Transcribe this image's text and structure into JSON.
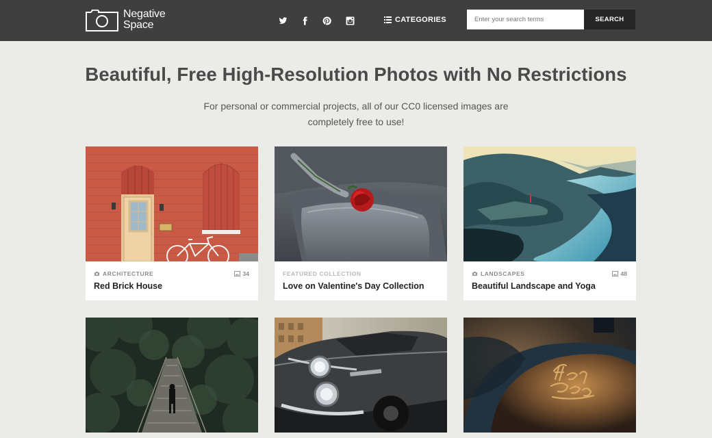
{
  "header": {
    "logo_line1": "Negative",
    "logo_line2": "Space",
    "social_icons": [
      "twitter-icon",
      "facebook-icon",
      "pinterest-icon",
      "instagram-icon"
    ],
    "categories_label": "CATEGORIES",
    "search_placeholder": "Enter your search terms",
    "search_button": "SEARCH"
  },
  "hero": {
    "headline": "Beautiful, Free High-Resolution Photos with No Restrictions",
    "subtitle_line1": "For personal or commercial projects, all of our CC0 licensed images are",
    "subtitle_line2": "completely free to use!"
  },
  "cards": [
    {
      "category": "ARCHITECTURE",
      "title": "Red Brick House",
      "count": "34",
      "has_camera_icon": true
    },
    {
      "category": "FEATURED COLLECTION",
      "title": "Love on Valentine's Day Collection",
      "count": ""
    },
    {
      "category": "LANDSCAPES",
      "title": "Beautiful Landscape and Yoga",
      "count": "48",
      "has_camera_icon": true
    },
    {
      "category": "",
      "title": "",
      "count": ""
    },
    {
      "category": "",
      "title": "",
      "count": ""
    },
    {
      "category": "",
      "title": "",
      "count": ""
    }
  ],
  "colors": {
    "header_bg": "#3f3f3f",
    "page_bg": "#ebebe8",
    "search_button_bg": "#262626"
  }
}
